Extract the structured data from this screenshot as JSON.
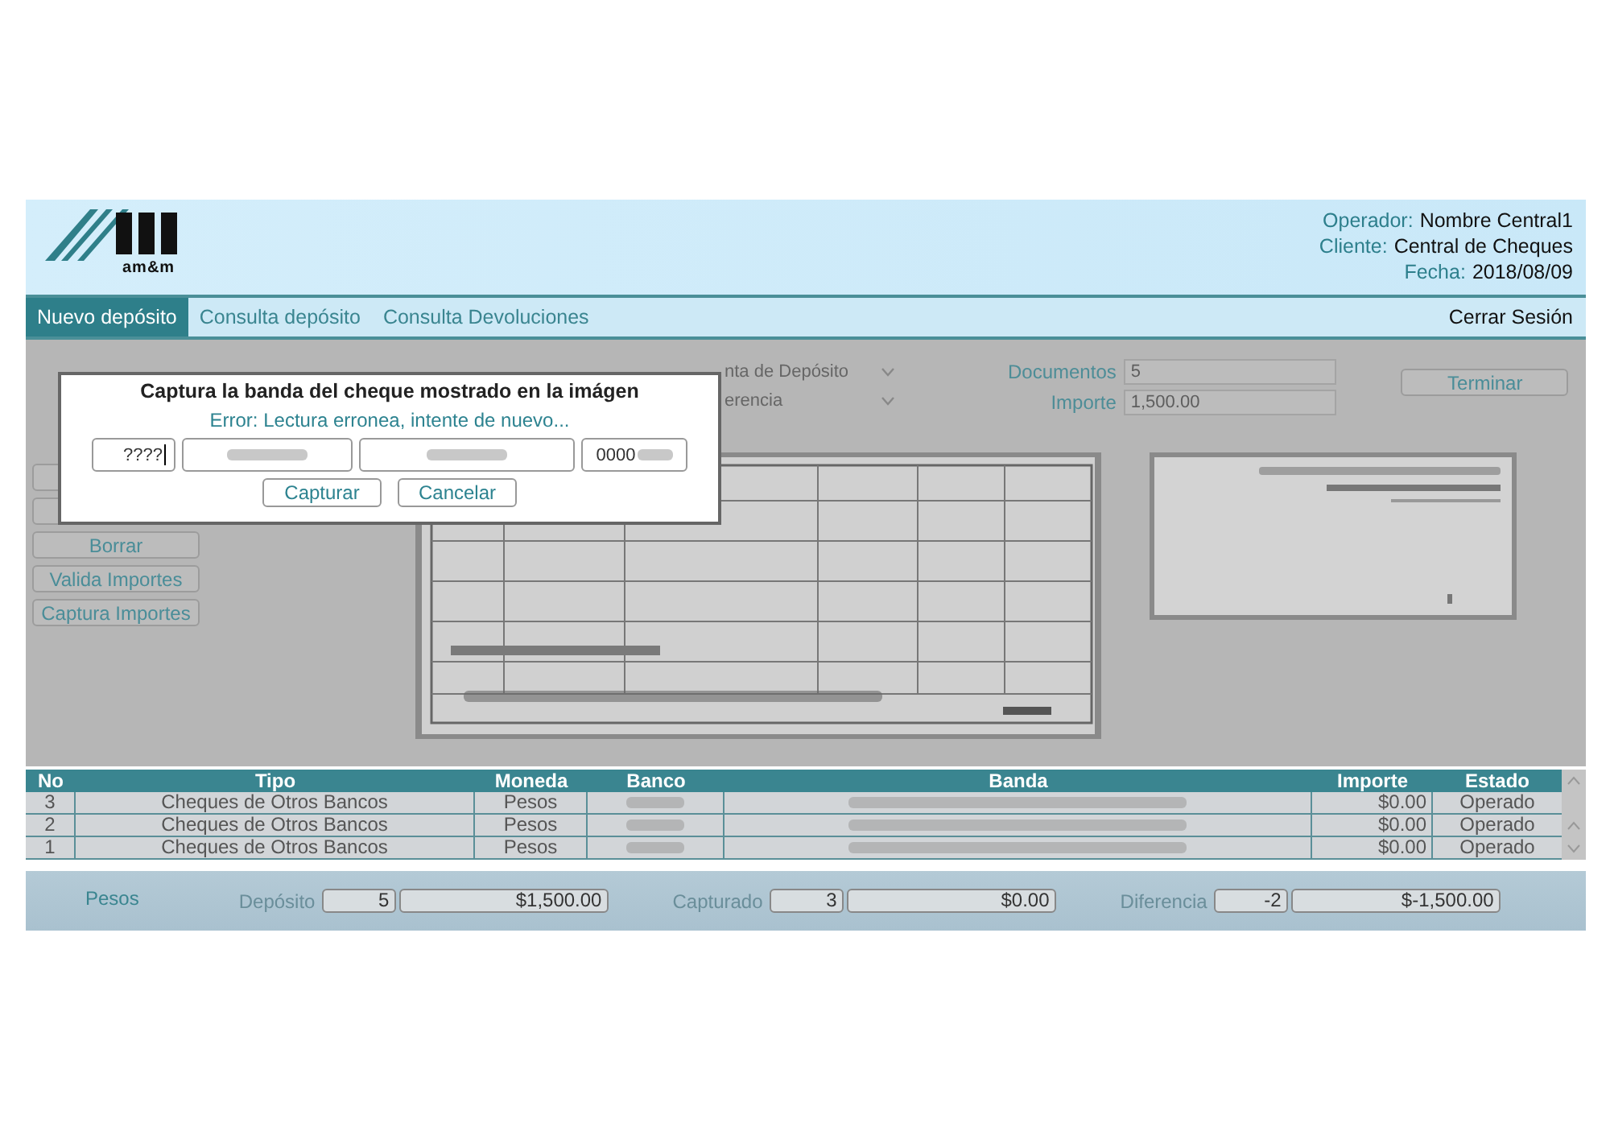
{
  "header": {
    "logo_text": "am&m",
    "info": [
      {
        "label": "Operador:",
        "value": "Nombre Central1"
      },
      {
        "label": "Cliente:",
        "value": "Central de Cheques"
      },
      {
        "label": "Fecha:",
        "value": "2018/08/09"
      }
    ]
  },
  "nav": {
    "tabs": [
      {
        "label": "Nuevo depósito",
        "selected": true
      },
      {
        "label": "Consulta depósito",
        "selected": false
      },
      {
        "label": "Consulta Devoluciones",
        "selected": false
      }
    ],
    "logout": "Cerrar Sesión"
  },
  "form": {
    "dropdowns": [
      {
        "value": "nta de Depósito"
      },
      {
        "value": "erencia"
      }
    ],
    "fields": [
      {
        "label": "Documentos",
        "value": "5"
      },
      {
        "label": "Importe",
        "value": "1,500.00"
      }
    ],
    "finish_button": "Terminar"
  },
  "side_buttons": [
    {
      "label": "Borrar"
    },
    {
      "label": "Valida Importes"
    },
    {
      "label": "Captura Importes"
    }
  ],
  "dialog": {
    "title": "Captura la banda del cheque mostrado en la imágen",
    "error": "Error: Lectura erronea, intente de nuevo...",
    "band_fields": [
      {
        "value": "????",
        "blurred": false
      },
      {
        "blurred": true
      },
      {
        "blurred": true
      },
      {
        "value": "0000",
        "blurred": true
      }
    ],
    "buttons": [
      "Capturar",
      "Cancelar"
    ]
  },
  "table": {
    "columns": [
      "No",
      "Tipo",
      "Moneda",
      "Banco",
      "Banda",
      "Importe",
      "Estado"
    ],
    "rows": [
      {
        "no": "3",
        "tipo": "Cheques de Otros Bancos",
        "moneda": "Pesos",
        "importe": "$0.00",
        "estado": "Operado"
      },
      {
        "no": "2",
        "tipo": "Cheques de Otros Bancos",
        "moneda": "Pesos",
        "importe": "$0.00",
        "estado": "Operado"
      },
      {
        "no": "1",
        "tipo": "Cheques de Otros Bancos",
        "moneda": "Pesos",
        "importe": "$0.00",
        "estado": "Operado"
      }
    ]
  },
  "totals": {
    "currency": "Pesos",
    "groups": [
      {
        "label": "Depósito",
        "count": "5",
        "amount": "$1,500.00"
      },
      {
        "label": "Capturado",
        "count": "3",
        "amount": "$0.00"
      },
      {
        "label": "Diferencia",
        "count": "-2",
        "amount": "$-1,500.00"
      }
    ]
  }
}
